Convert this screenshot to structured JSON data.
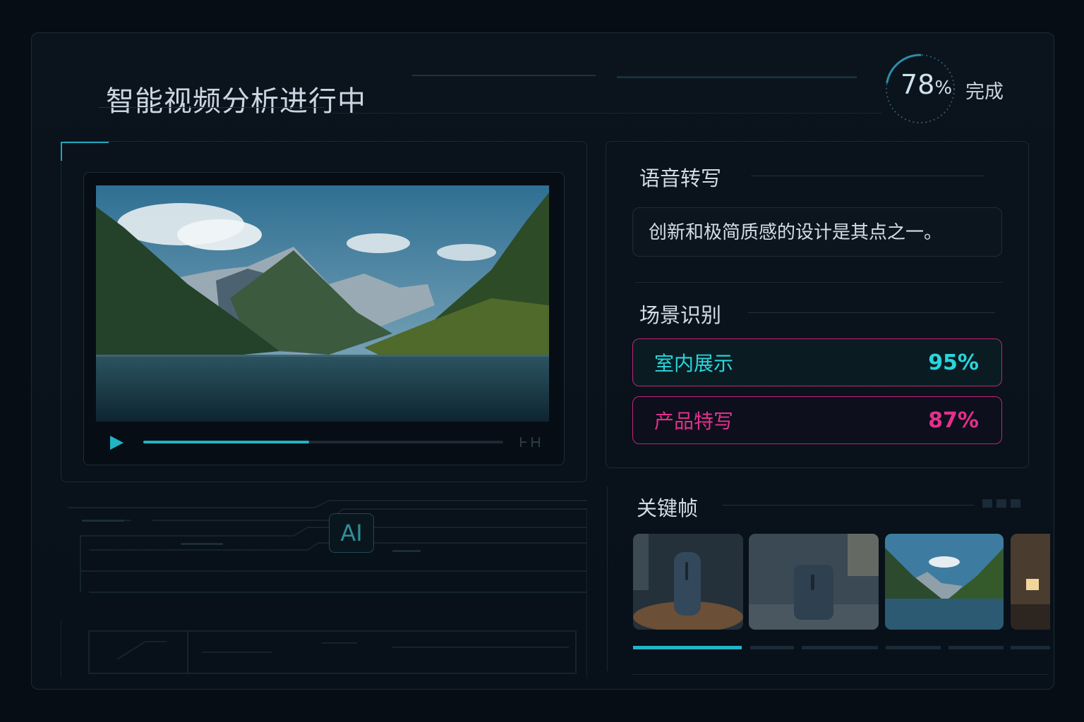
{
  "header": {
    "title": "智能视频分析进行中",
    "progress_value": "78",
    "progress_unit": "%",
    "progress_fraction": 0.78,
    "progress_label": "完成"
  },
  "video": {
    "playback_fraction": 0.46
  },
  "ai_badge": "AI",
  "transcript": {
    "heading": "语音转写",
    "text": "创新和极简质感的设计是其点之一。"
  },
  "scenes": {
    "heading": "场景识别",
    "items": [
      {
        "label": "室内展示",
        "value": "95%"
      },
      {
        "label": "产品特写",
        "value": "87%"
      }
    ]
  },
  "keyframes": {
    "heading": "关键帧",
    "active_index": 0
  },
  "colors": {
    "accent_cyan": "#27d6dd",
    "accent_magenta": "#e2308c",
    "progress_track": "#1fb5c6",
    "background": "#070d14"
  }
}
